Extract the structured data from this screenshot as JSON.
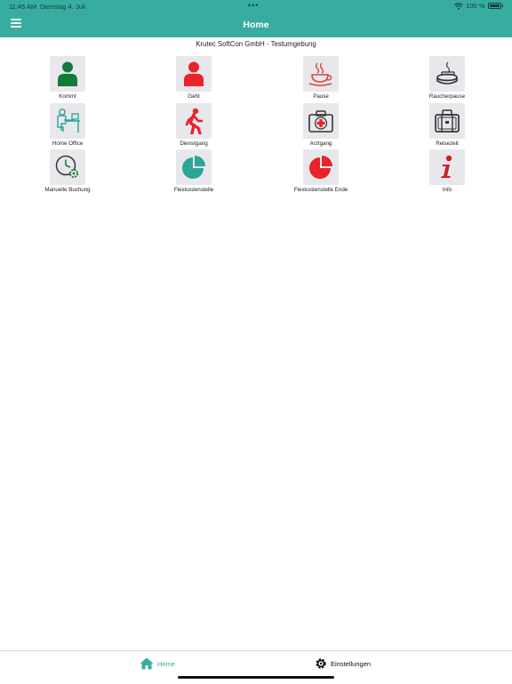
{
  "status_bar": {
    "time": "11:45 AM",
    "date": "Dienstag 4. Juli",
    "dots": "•••",
    "battery": "100 %"
  },
  "header": {
    "title": "Home",
    "subtitle": "Krutec SoftCon GmbH - Testumgebung"
  },
  "tiles": [
    {
      "label": "Kommt",
      "icon": "person-icon",
      "color": "#137a3a"
    },
    {
      "label": "Geht",
      "icon": "person-icon",
      "color": "#e8242a"
    },
    {
      "label": "Pause",
      "icon": "coffee-cup-icon",
      "color": "#d9453a"
    },
    {
      "label": "Raucherpause",
      "icon": "ashtray-icon",
      "color": "#444444"
    },
    {
      "label": "Home Office",
      "icon": "desk-worker-icon",
      "color": "#2aa596"
    },
    {
      "label": "Dienstgang",
      "icon": "walking-person-icon",
      "color": "#e8242a"
    },
    {
      "label": "Arztgang",
      "icon": "first-aid-kit-icon",
      "color": "#e8242a"
    },
    {
      "label": "Reisezeit",
      "icon": "suitcase-icon",
      "color": "#333333"
    },
    {
      "label": "Manuelle Buchung",
      "icon": "clock-gear-icon",
      "color": "#137a3a"
    },
    {
      "label": "Flexkostenstelle",
      "icon": "pie-chart-icon",
      "color": "#2aa596"
    },
    {
      "label": "Flexkostenstelle Ende",
      "icon": "pie-chart-icon",
      "color": "#e8242a"
    },
    {
      "label": "Info",
      "icon": "info-icon",
      "color": "#cc2222"
    }
  ],
  "tabbar": {
    "home_label": "Home",
    "settings_label": "Einstellungen",
    "home_icon": "house-icon",
    "settings_icon": "gear-icon",
    "active_color": "#36ada0"
  },
  "theme": {
    "accent": "#36ada0",
    "tile_bg": "#e8e8ec"
  }
}
